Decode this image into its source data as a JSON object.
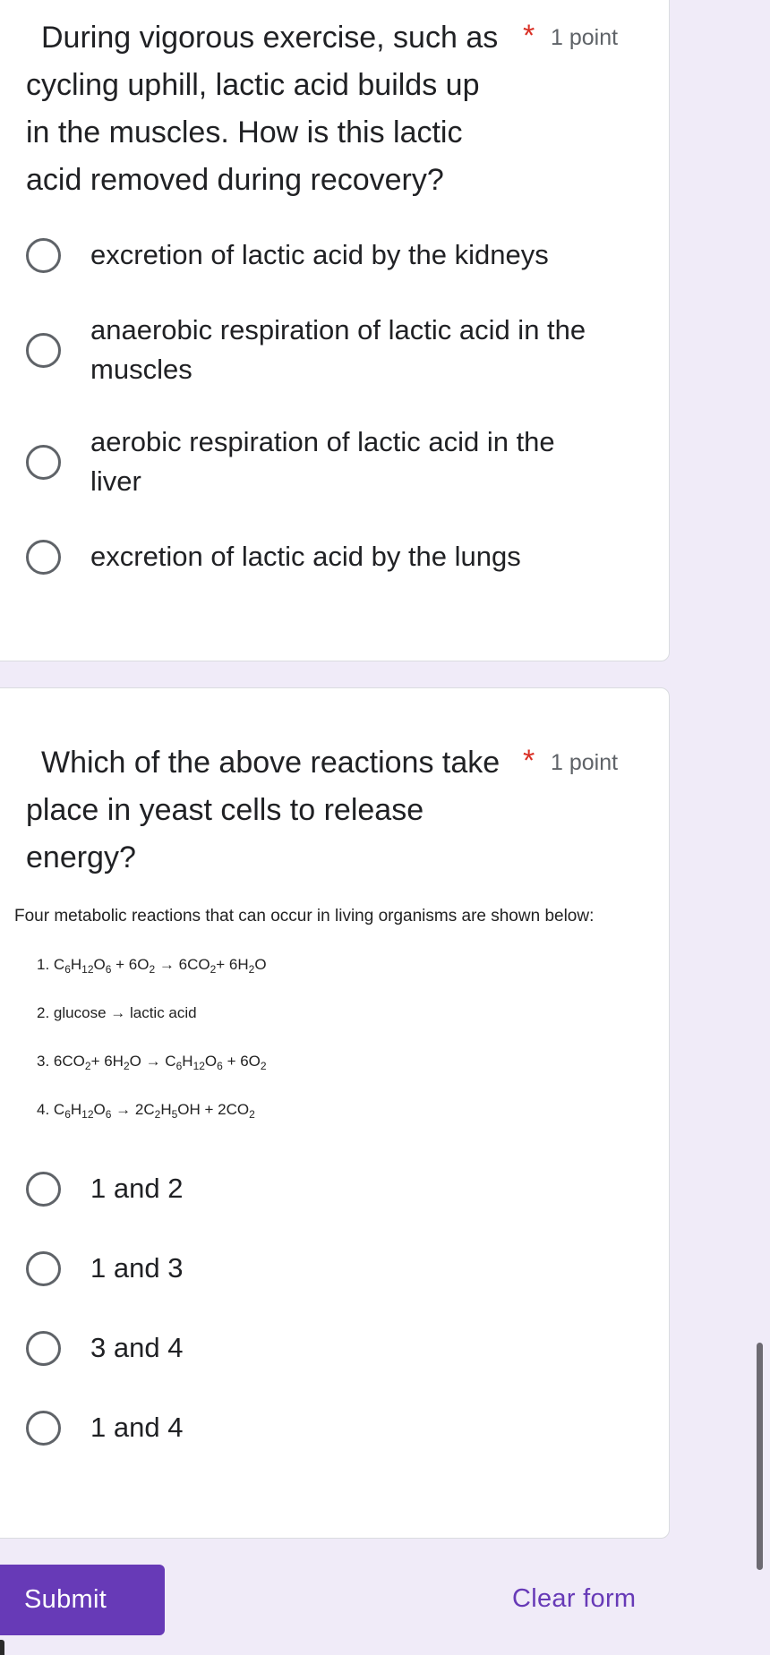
{
  "questions": [
    {
      "title": "During vigorous exercise, such as cycling uphill, lactic acid builds up in the muscles. How is this lactic acid removed during recovery?",
      "required_marker": "*",
      "points": "1 point",
      "options": [
        "excretion of lactic acid by the kidneys",
        "anaerobic respiration of lactic acid in the muscles",
        "aerobic respiration of lactic acid in the liver",
        "excretion of lactic acid by the lungs"
      ]
    },
    {
      "title": "Which of the above reactions take place in yeast cells to release energy?",
      "required_marker": "*",
      "points": "1 point",
      "image": {
        "intro": "Four metabolic reactions that can occur in living organisms are shown below:",
        "reactions": [
          {
            "num": "1.",
            "text": "C6H12O6 + 6O2 → 6CO2+ 6H2O"
          },
          {
            "num": "2.",
            "text": "glucose → lactic acid"
          },
          {
            "num": "3.",
            "text": "6CO2+ 6H2O → C6H12O6 + 6O2"
          },
          {
            "num": "4.",
            "text": "C6H12O6 → 2C2H5OH + 2CO2"
          }
        ]
      },
      "options": [
        "1 and 2",
        "1 and 3",
        "3 and 4",
        "1 and 4"
      ]
    }
  ],
  "footer": {
    "submit_label": "Submit",
    "clear_label": "Clear form"
  },
  "colors": {
    "accent": "#673ab7",
    "required": "#d93025",
    "page_background": "#f0ebf8"
  }
}
